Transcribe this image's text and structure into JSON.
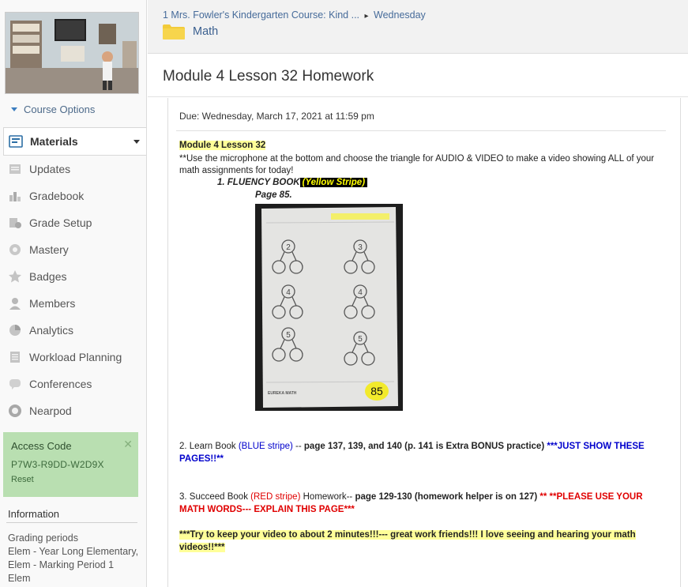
{
  "sidebar": {
    "course_options": "Course Options",
    "nav": [
      {
        "label": "Materials",
        "icon": "materials-icon",
        "active": true
      },
      {
        "label": "Updates",
        "icon": "updates-icon"
      },
      {
        "label": "Gradebook",
        "icon": "gradebook-icon"
      },
      {
        "label": "Grade Setup",
        "icon": "grade-setup-icon"
      },
      {
        "label": "Mastery",
        "icon": "mastery-icon"
      },
      {
        "label": "Badges",
        "icon": "badges-icon"
      },
      {
        "label": "Members",
        "icon": "members-icon"
      },
      {
        "label": "Analytics",
        "icon": "analytics-icon"
      },
      {
        "label": "Workload Planning",
        "icon": "workload-icon"
      },
      {
        "label": "Conferences",
        "icon": "conferences-icon"
      },
      {
        "label": "Nearpod",
        "icon": "nearpod-icon"
      }
    ],
    "access_code": {
      "title": "Access Code",
      "code": "P7W3-R9DD-W2D9X",
      "reset": "Reset"
    },
    "information": {
      "title": "Information",
      "lines": [
        "Grading periods",
        "Elem - Year Long Elementary,",
        "Elem - Marking Period 1",
        "Elem"
      ]
    }
  },
  "header": {
    "breadcrumb_course": "1 Mrs. Fowler's Kindergarten Course: Kind ...",
    "breadcrumb_sep": "▸",
    "breadcrumb_folder": "Wednesday",
    "folder_title": "Math",
    "page_title": "Module 4 Lesson 32 Homework"
  },
  "assignment": {
    "due": "Due: Wednesday, March 17, 2021 at 11:59 pm",
    "heading": "Module 4  Lesson 32",
    "intro": "**Use the microphone at the bottom and choose the triangle for AUDIO & VIDEO to make a video showing ALL of your math assignments for today!",
    "item1_label": "1. FLUENCY BOOK",
    "item1_tag": "(Yellow Stripe)",
    "item1_page": "Page 85.",
    "worksheet_numbers": [
      "2",
      "3",
      "4",
      "4",
      "5",
      "5"
    ],
    "worksheet_page": "85",
    "worksheet_brand": "EUREKA MATH",
    "item2_prefix": "2.  Learn Book ",
    "item2_color": "(BLUE stripe)",
    "item2_dash": " -- ",
    "item2_pages": "page 137, 139, and 140 (p. 141 is Extra BONUS practice) ",
    "item2_note": "***JUST SHOW THESE PAGES!!**",
    "item3_prefix": "3. Succeed Book ",
    "item3_color": "(RED stripe)",
    "item3_mid": " Homework-- ",
    "item3_pages": "page 129-130  (homework helper is on 127) ",
    "item3_note": "** **PLEASE USE YOUR MATH WORDS--- EXPLAIN THIS PAGE***",
    "closing": "***Try to keep your video to about 2 minutes!!!--- great work friends!!!  I love seeing and hearing your math videos!!***"
  },
  "colors": {
    "accent": "#3a5f8f",
    "access_bg": "#b9dfb1",
    "highlight": "#ffff99",
    "blue": "#0000cc",
    "red": "#e00000"
  }
}
